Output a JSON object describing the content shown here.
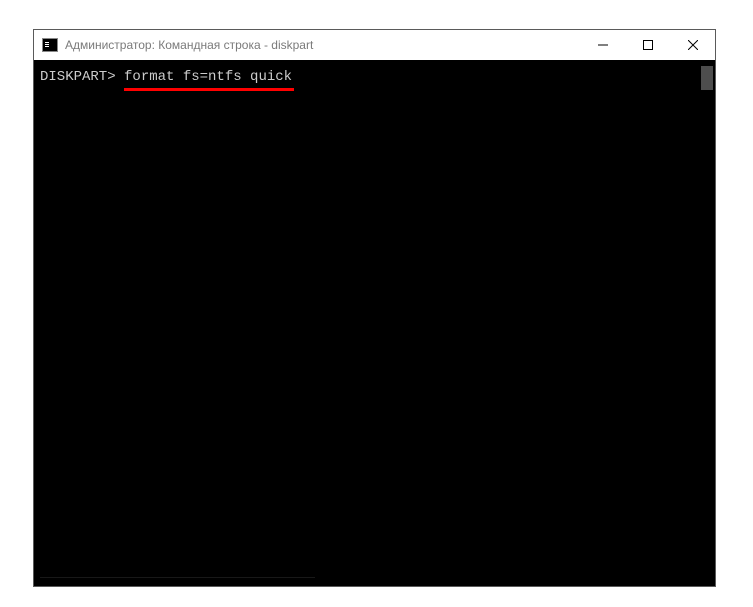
{
  "window": {
    "title": "Администратор: Командная строка - diskpart"
  },
  "console": {
    "prompt": "DISKPART> ",
    "command": "format fs=ntfs quick"
  },
  "colors": {
    "underline": "#ff0000",
    "console_bg": "#000000",
    "console_fg": "#cccccc"
  }
}
